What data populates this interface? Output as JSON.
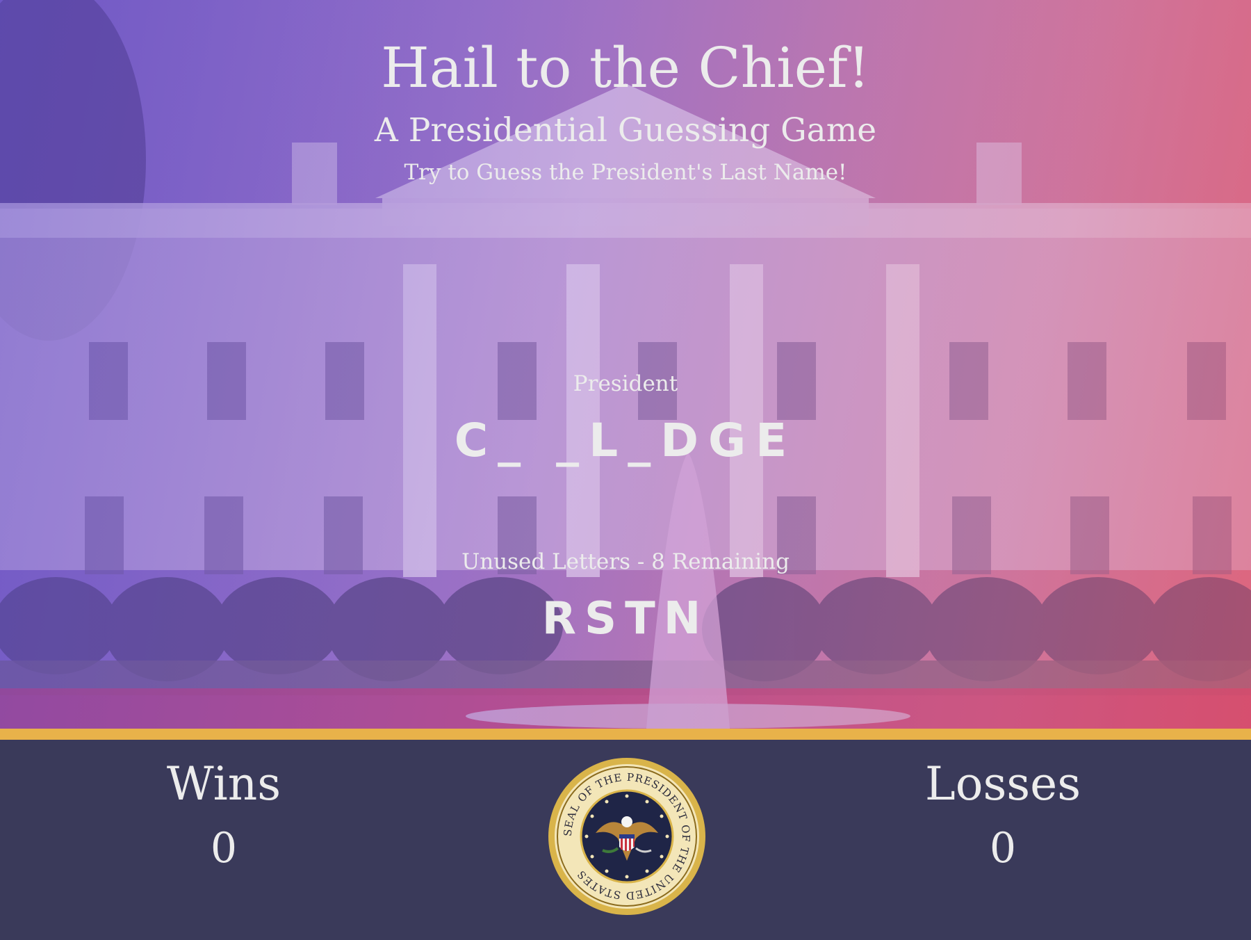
{
  "header": {
    "title": "Hail to the Chief!",
    "subtitle": "A Presidential Guessing Game",
    "instructions": "Try to Guess the President's Last Name!"
  },
  "game": {
    "president_label": "President",
    "word_display": "C_ _L_DGE",
    "unused_label": "Unused Letters - 8 Remaining",
    "unused_letters": "RSTN"
  },
  "scoreboard": {
    "wins_label": "Wins",
    "wins_value": "0",
    "losses_label": "Losses",
    "losses_value": "0"
  },
  "seal": {
    "ring_text": "SEAL OF THE PRESIDENT OF THE UNITED STATES",
    "icon": "presidential-seal-icon"
  },
  "colors": {
    "accent_gold": "#e8b24a",
    "footer_bg": "#3a3a5a",
    "text": "#ececec"
  }
}
